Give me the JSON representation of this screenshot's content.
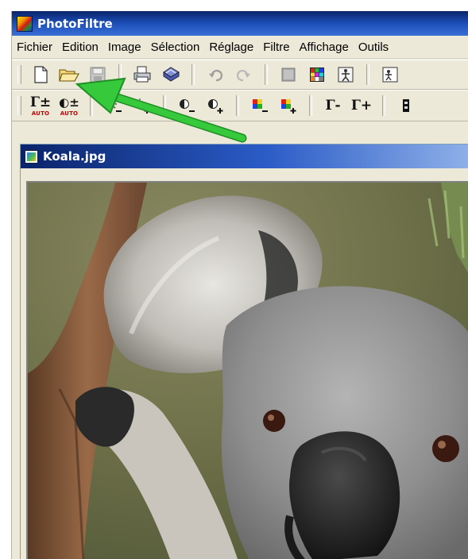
{
  "app": {
    "title": "PhotoFiltre"
  },
  "menu": [
    "Fichier",
    "Edition",
    "Image",
    "Sélection",
    "Réglage",
    "Filtre",
    "Affichage",
    "Outils"
  ],
  "toolbar1": {
    "buttons": [
      "new-document-icon",
      "open-folder-icon",
      "save-disk-icon",
      "print-icon",
      "scan-icon",
      "undo-icon",
      "redo-icon",
      "gray-square-icon",
      "color-palette-icon",
      "transform-icon",
      "picture-icon"
    ]
  },
  "toolbar2": {
    "auto_label": "AUTO",
    "gamma_plus_minus": "Γ±",
    "gamma_minus": "Γ-",
    "gamma_plus": "Γ+",
    "contrast_plus_minus": "◐±"
  },
  "document": {
    "title": "Koala.jpg",
    "image": "koala-photo"
  },
  "annotation": {
    "arrow_color": "#2fbf35",
    "target": "open-folder-icon"
  },
  "colors": {
    "titlebar": "#0a246a",
    "chrome": "#ece9d8",
    "arrow": "#2fbf35"
  }
}
